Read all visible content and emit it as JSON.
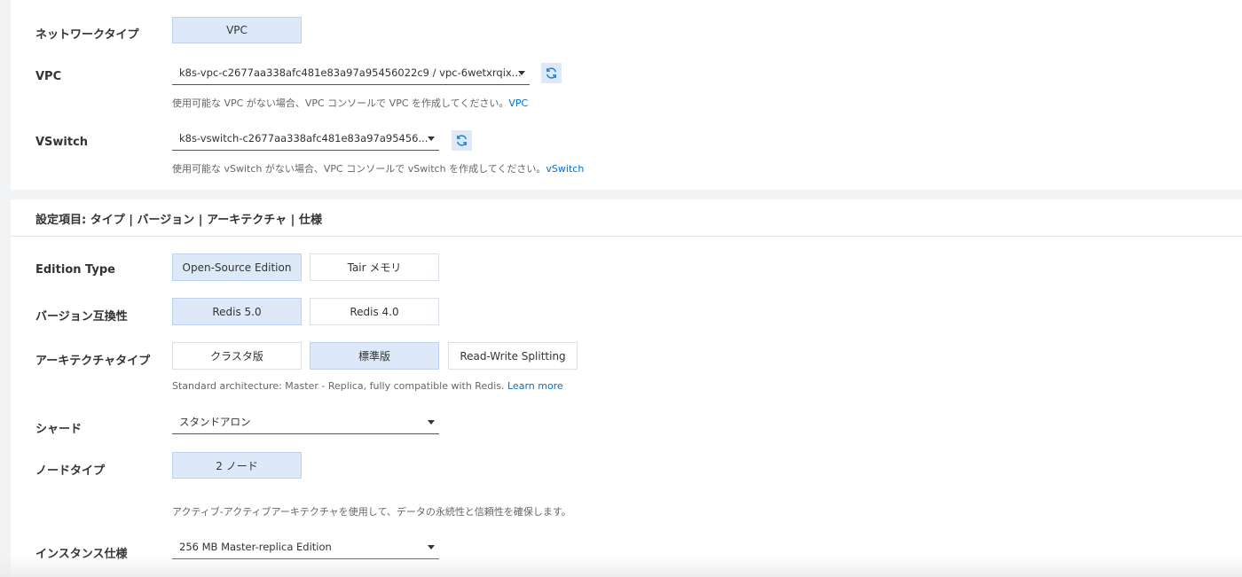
{
  "network": {
    "network_type": {
      "label": "ネットワークタイプ",
      "value": "VPC"
    },
    "vpc": {
      "label": "VPC",
      "selected": "k8s-vpc-c2677aa338afc481e83a97a95456022c9 / vpc-6wetxrqix...",
      "help_text": "使用可能な VPC がない場合、VPC コンソールで VPC を作成してください。",
      "help_link": "VPC"
    },
    "vswitch": {
      "label": "VSwitch",
      "selected": "k8s-vswitch-c2677aa338afc481e83a97a95456...",
      "help_text": "使用可能な vSwitch がない場合、VPC コンソールで vSwitch を作成してください。",
      "help_link": "vSwitch"
    }
  },
  "config": {
    "section_title": "設定項目: タイプ | バージョン | アーキテクチャ | 仕様",
    "edition_type": {
      "label": "Edition Type",
      "options": [
        "Open-Source Edition",
        "Tair メモリ"
      ],
      "selected_index": 0
    },
    "version": {
      "label": "バージョン互換性",
      "options": [
        "Redis 5.0",
        "Redis 4.0"
      ],
      "selected_index": 0
    },
    "architecture": {
      "label": "アーキテクチャタイプ",
      "options": [
        "クラスタ版",
        "標準版",
        "Read-Write Splitting"
      ],
      "selected_index": 1,
      "help_text": "Standard architecture: Master - Replica, fully compatible with Redis.",
      "help_link": "Learn more"
    },
    "shard": {
      "label": "シャード",
      "selected": "スタンドアロン"
    },
    "node_type": {
      "label": "ノードタイプ",
      "value": "2 ノード",
      "help_text": "アクティブ-アクティブアーキテクチャを使用して、データの永続性と信頼性を確保します。"
    },
    "instance_spec": {
      "label": "インスタンス仕様",
      "selected": "256 MB Master-replica Edition"
    }
  },
  "colors": {
    "selected_bg": "#dde9f8",
    "link": "#0070cc",
    "refresh_icon": "#1f7fd6"
  },
  "icons": {
    "refresh": "refresh-icon",
    "dropdown": "caret-down-icon"
  }
}
